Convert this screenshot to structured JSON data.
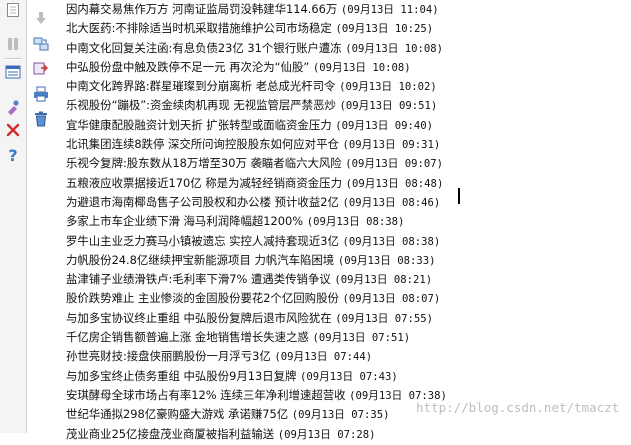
{
  "toolbar": {
    "icons": [
      "page-icon",
      "arrow-down-icon",
      "pause-icon",
      "linked-panes-icon",
      "layout-icon",
      "export-icon",
      "filter-icon",
      "print-icon",
      "trash-icon",
      "pin-icon",
      "remove-icon",
      "help-icon"
    ]
  },
  "news": [
    {
      "headline": "因内幕交易焦作万方 河南证监局罚没韩建华114.66万",
      "time": "(09月13日 11:04)"
    },
    {
      "headline": "北大医药:不排除适当时机采取措施维护公司市场稳定",
      "time": "(09月13日 10:25)"
    },
    {
      "headline": "中南文化回复关注函:有息负债23亿 31个银行账户遭冻",
      "time": "(09月13日 10:08)"
    },
    {
      "headline": "中弘股份盘中触及跌停不足一元 再次沦为“仙股”",
      "time": "(09月13日 10:08)"
    },
    {
      "headline": "中南文化跨界路:群星璀璨到分崩离析 老总成光杆司令",
      "time": "(09月13日 10:02)"
    },
    {
      "headline": "乐视股份“蹦极”:资金续肉机再现 无视监管层严禁恶炒",
      "time": "(09月13日 09:51)"
    },
    {
      "headline": "宜华健康配股融资计划天折 扩张转型或面临资金压力",
      "time": "(09月13日 09:40)"
    },
    {
      "headline": "北讯集团连续8跌停 深交所问询控股股东如何应对平仓",
      "time": "(09月13日 09:31)"
    },
    {
      "headline": "乐视今复牌:股东数从18万增至30万 袭瞄者临六大风险",
      "time": "(09月13日 09:07)"
    },
    {
      "headline": "五粮液应收票据接近170亿 称是为减轻经销商资金压力",
      "time": "(09月13日 08:48)"
    },
    {
      "headline": "为避退市海南椰岛售子公司股权和办公楼 预计收益2亿",
      "time": "(09月13日 08:46)"
    },
    {
      "headline": "多家上市车企业绩下滑 海马利润降幅超1200%",
      "time": "(09月13日 08:38)"
    },
    {
      "headline": "罗牛山主业乏力赛马小镇被遗忘 实控人减持套现近3亿",
      "time": "(09月13日 08:38)"
    },
    {
      "headline": "力帆股份24.8亿继续押宝新能源项目 力帆汽车陷困境",
      "time": "(09月13日 08:33)"
    },
    {
      "headline": "盐津铺子业绩滑铁卢:毛利率下滑7% 遭遇类传销争议",
      "time": "(09月13日 08:21)"
    },
    {
      "headline": "股价跌势难止 主业惨淡的金固股份要花2个亿回购股份",
      "time": "(09月13日 08:07)"
    },
    {
      "headline": "与加多宝协议终止重组 中弘股份复牌后退市风险犹在",
      "time": "(09月13日 07:55)"
    },
    {
      "headline": "千亿房企销售额普遍上涨 金地销售增长失速之惑",
      "time": "(09月13日 07:51)"
    },
    {
      "headline": "孙世亮财技:接盘侠丽鹏股份一月浮亏3亿",
      "time": "(09月13日 07:44)"
    },
    {
      "headline": "与加多宝终止债务重组 中弘股份9月13日复牌",
      "time": "(09月13日 07:43)"
    },
    {
      "headline": "安琪酵母全球市场占有率12% 连续三年净利增速超营收",
      "time": "(09月13日 07:38)"
    },
    {
      "headline": "世纪华通拟298亿豪购盛大游戏 承诺赚75亿",
      "time": "(09月13日 07:35)"
    },
    {
      "headline": "茂业商业25亿接盘茂业商厦被指利益输送",
      "time": "(09月13日 07:28)"
    }
  ],
  "watermark": "http://blog.csdn.net/tmaczt"
}
